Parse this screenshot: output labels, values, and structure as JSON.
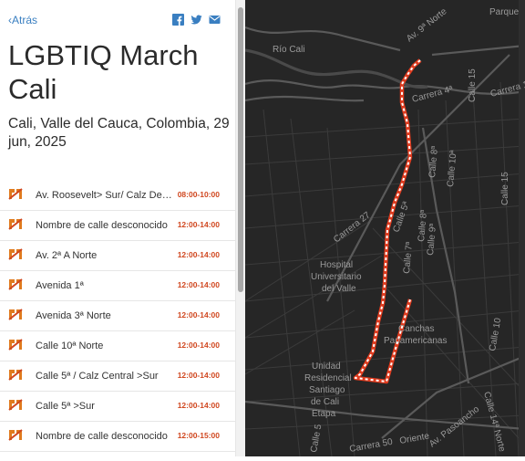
{
  "header": {
    "back_label": "Atrás",
    "share_icons": [
      "facebook-icon",
      "twitter-icon",
      "email-icon"
    ]
  },
  "event": {
    "title": "LGBTIQ March Cali",
    "subtitle": "Cali, Valle del Cauca, Colombia, 29 jun, 2025"
  },
  "closures": [
    {
      "street": "Av. Roosevelt> Sur/ Calz Der...",
      "time": "08:00-10:00"
    },
    {
      "street": "Nombre de calle desconocido",
      "time": "12:00-14:00"
    },
    {
      "street": "Av. 2ª A Norte",
      "time": "12:00-14:00"
    },
    {
      "street": "Avenida 1ª",
      "time": "12:00-14:00"
    },
    {
      "street": "Avenida 3ª Norte",
      "time": "12:00-14:00"
    },
    {
      "street": "Calle 10ª Norte",
      "time": "12:00-14:00"
    },
    {
      "street": "Calle 5ª / Calz Central >Sur",
      "time": "12:00-14:00"
    },
    {
      "street": "Calle 5ª >Sur",
      "time": "12:00-14:00"
    },
    {
      "street": "Nombre de calle desconocido",
      "time": "12:00-15:00"
    }
  ],
  "map": {
    "labels": [
      {
        "text": "Av. 9ª Norte",
        "id": "av9"
      },
      {
        "text": "Parque",
        "id": "parque"
      },
      {
        "text": "Río Cali",
        "id": "riocali"
      },
      {
        "text": "Carrera 4ª",
        "id": "cra4"
      },
      {
        "text": "Carrera 1ª",
        "id": "cra1"
      },
      {
        "text": "Calle 15",
        "id": "cl15a"
      },
      {
        "text": "Calle 8ª",
        "id": "cl8"
      },
      {
        "text": "Calle 10ª",
        "id": "cl10"
      },
      {
        "text": "Calle 15",
        "id": "cl15b"
      },
      {
        "text": "Carrera 27",
        "id": "cra27"
      },
      {
        "text": "Calle 5ª",
        "id": "cl5"
      },
      {
        "text": "Calle 8ª",
        "id": "cl8b"
      },
      {
        "text": "Calle 9ª",
        "id": "cl9"
      },
      {
        "text": "Calle 7ª",
        "id": "cl7"
      },
      {
        "text": "Hospital",
        "id": "hosp1"
      },
      {
        "text": "Universitario",
        "id": "hosp2"
      },
      {
        "text": "del Valle",
        "id": "hosp3"
      },
      {
        "text": "Canchas",
        "id": "canch1"
      },
      {
        "text": "Panamericanas",
        "id": "canch2"
      },
      {
        "text": "Calle 10",
        "id": "cl10b"
      },
      {
        "text": "Calle 14ª Norte",
        "id": "cl14"
      },
      {
        "text": "Unidad",
        "id": "u1"
      },
      {
        "text": "Residencial",
        "id": "u2"
      },
      {
        "text": "Santiago",
        "id": "u3"
      },
      {
        "text": "de Cali",
        "id": "u4"
      },
      {
        "text": "Etapa",
        "id": "u5"
      },
      {
        "text": "Av. Pasoancho",
        "id": "pasoancho"
      },
      {
        "text": "Carrera 50",
        "id": "cra50"
      },
      {
        "text": "Oriente",
        "id": "oriente"
      },
      {
        "text": "Calle 5",
        "id": "cl5b"
      }
    ]
  },
  "colors": {
    "accent_link": "#3a7fc1",
    "time_red": "#d0471f",
    "route_red": "#e03b1e",
    "map_bg": "#262626"
  }
}
